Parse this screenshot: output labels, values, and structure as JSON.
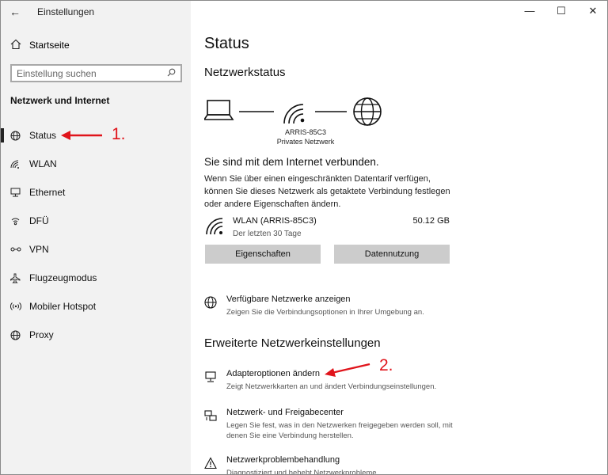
{
  "window": {
    "title": "Einstellungen"
  },
  "sidebar": {
    "home_label": "Startseite",
    "search_placeholder": "Einstellung suchen",
    "section_title": "Netzwerk und Internet",
    "items": [
      {
        "label": "Status",
        "icon": "globe-status-icon",
        "active": true
      },
      {
        "label": "WLAN",
        "icon": "wifi-icon"
      },
      {
        "label": "Ethernet",
        "icon": "ethernet-icon"
      },
      {
        "label": "DFÜ",
        "icon": "dialup-icon"
      },
      {
        "label": "VPN",
        "icon": "vpn-icon"
      },
      {
        "label": "Flugzeugmodus",
        "icon": "airplane-icon"
      },
      {
        "label": "Mobiler Hotspot",
        "icon": "hotspot-icon"
      },
      {
        "label": "Proxy",
        "icon": "globe-icon"
      }
    ]
  },
  "main": {
    "title": "Status",
    "network_status_heading": "Netzwerkstatus",
    "diagram": {
      "ssid": "ARRIS-85C3",
      "network_type": "Privates Netzwerk"
    },
    "connected_text": "Sie sind mit dem Internet verbunden.",
    "metered_description": "Wenn Sie über einen eingeschränkten Datentarif verfügen, können Sie dieses Netzwerk als getaktete Verbindung festlegen oder andere Eigenschaften ändern.",
    "connection": {
      "name": "WLAN (ARRIS-85C3)",
      "period": "Der letzten 30 Tage",
      "usage": "50.12 GB"
    },
    "buttons": {
      "properties": "Eigenschaften",
      "data_usage": "Datennutzung"
    },
    "available_networks": {
      "title": "Verfügbare Netzwerke anzeigen",
      "description": "Zeigen Sie die Verbindungsoptionen in Ihrer Umgebung an."
    },
    "advanced_heading": "Erweiterte Netzwerkeinstellungen",
    "links": [
      {
        "title": "Adapteroptionen ändern",
        "description": "Zeigt Netzwerkkarten an und ändert Verbindungseinstellungen."
      },
      {
        "title": "Netzwerk- und Freigabecenter",
        "description": "Legen Sie fest, was in den Netzwerken freigegeben werden soll, mit denen Sie eine Verbindung herstellen."
      },
      {
        "title": "Netzwerkproblembehandlung",
        "description": "Diagnostiziert und behebt Netzwerkprobleme."
      }
    ]
  },
  "annotations": {
    "step1": "1.",
    "step2": "2.",
    "color": "#e0141b"
  }
}
